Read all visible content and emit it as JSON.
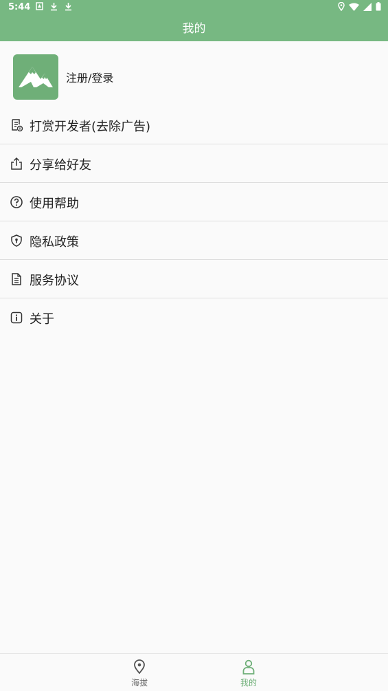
{
  "status_bar": {
    "time": "5:44",
    "left_icons": [
      "notification-icon",
      "download-icon",
      "download-icon"
    ],
    "right_icons": [
      "location-icon",
      "wifi-icon",
      "signal-icon",
      "battery-icon"
    ]
  },
  "header": {
    "title": "我的"
  },
  "profile": {
    "login_label": "注册/登录",
    "avatar_icon": "mountain-icon"
  },
  "menu": {
    "items": [
      {
        "label": "打赏开发者(去除广告)",
        "icon": "receipt-icon"
      },
      {
        "label": "分享给好友",
        "icon": "share-icon"
      },
      {
        "label": "使用帮助",
        "icon": "help-icon"
      },
      {
        "label": "隐私政策",
        "icon": "shield-icon"
      },
      {
        "label": "服务协议",
        "icon": "document-icon"
      },
      {
        "label": "关于",
        "icon": "info-icon"
      }
    ]
  },
  "tabs": [
    {
      "label": "海拔",
      "icon": "location-pin-icon",
      "active": false
    },
    {
      "label": "我的",
      "icon": "person-icon",
      "active": true
    }
  ],
  "colors": {
    "accent": "#77b882",
    "tab_active": "#6faf78",
    "tab_inactive": "#666666",
    "divider": "#dedede",
    "background": "#fafafa"
  }
}
